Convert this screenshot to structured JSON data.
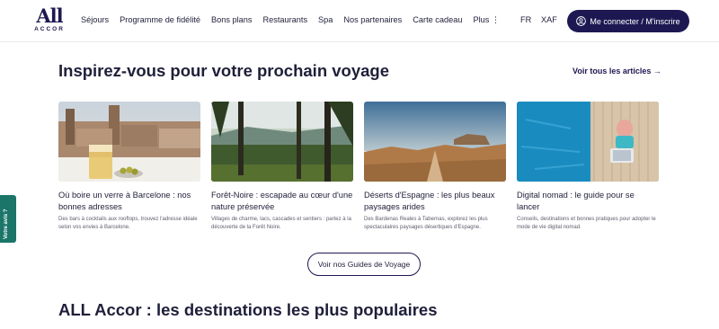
{
  "header": {
    "logo_top": "All",
    "logo_bottom": "ACCOR",
    "menu": [
      "Séjours",
      "Programme de fidélité",
      "Bons plans",
      "Restaurants",
      "Spa",
      "Nos partenaires",
      "Carte cadeau",
      "Plus ⋮"
    ],
    "language": "FR",
    "currency": "XAF",
    "login_label": "Me connecter / M'inscrire"
  },
  "inspiration": {
    "title": "Inspirez-vous pour votre prochain voyage",
    "see_all": "Voir tous les articles →",
    "articles": [
      {
        "title": "Où boire un verre à Barcelone : nos bonnes adresses",
        "desc": "Des bars à cocktails aux rooftops, trouvez l'adresse idéale selon vos envies à Barcelone."
      },
      {
        "title": "Forêt-Noire : escapade au cœur d'une nature préservée",
        "desc": "Villages de charme, lacs, cascades et sentiers : partez à la découverte de la Forêt Noire."
      },
      {
        "title": "Déserts d'Espagne : les plus beaux paysages arides",
        "desc": "Des Bardenas Reales à Tabernas, explorez les plus spectaculaires paysages désertiques d'Espagne."
      },
      {
        "title": "Digital nomad : le guide pour se lancer",
        "desc": "Conseils, destinations et bonnes pratiques pour adopter le mode de vie digital nomad."
      }
    ],
    "guides_button": "Voir nos Guides de Voyage"
  },
  "destinations": {
    "title": "ALL Accor : les destinations les plus populaires"
  },
  "feedback_tab": "Votre avis ?",
  "colors": {
    "brand": "#1e1852",
    "feedback": "#1b7569"
  }
}
